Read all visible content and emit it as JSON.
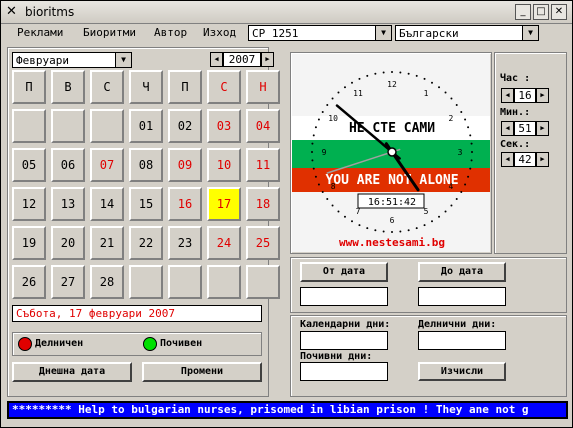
{
  "window": {
    "title": "bioritms"
  },
  "menu": [
    "Реклами",
    "Биоритми",
    "Автор",
    "Изход"
  ],
  "encoding_select": {
    "value": "CP 1251"
  },
  "language_select": {
    "value": "Български"
  },
  "calendar": {
    "month": "Февруари",
    "year": "2007",
    "weekdays": [
      "П",
      "В",
      "С",
      "Ч",
      "П",
      "С",
      "Н"
    ],
    "weeks": [
      [
        "",
        "",
        "",
        "01",
        "02",
        "03",
        "04"
      ],
      [
        "05",
        "06",
        "07",
        "08",
        "09",
        "10",
        "11"
      ],
      [
        "12",
        "13",
        "14",
        "15",
        "16",
        "17",
        "18"
      ],
      [
        "19",
        "20",
        "21",
        "22",
        "23",
        "24",
        "25"
      ],
      [
        "26",
        "27",
        "28",
        "",
        "",
        "",
        ""
      ]
    ],
    "red_days": [
      "03",
      "04",
      "07",
      "09",
      "10",
      "11",
      "16",
      "17",
      "18",
      "24",
      "25"
    ],
    "selected_day": "17",
    "selected_date_text": "Събота, 17 февруари 2007"
  },
  "legend": {
    "workday": "Делничен",
    "holiday": "Почивен",
    "workday_color": "#e00000",
    "holiday_color": "#00e000"
  },
  "buttons": {
    "today": "Днешна дата",
    "change": "Промени",
    "from_date": "От дата",
    "to_date": "До дата",
    "calculate": "Изчисли"
  },
  "clock": {
    "numbers": [
      "12",
      "1",
      "2",
      "3",
      "4",
      "5",
      "6",
      "7",
      "8",
      "9",
      "10",
      "11"
    ],
    "bg_text": "НЕ СТЕ САМИ",
    "red_text": "YOU ARE NOT ALONE",
    "digital_time": "16:51:42",
    "website": "www.nestesami.bg",
    "flag_colors": [
      "#ffffff",
      "#00b050",
      "#e03000"
    ]
  },
  "time": {
    "hour_label": "Час :",
    "hour": "16",
    "min_label": "Мин.:",
    "min": "51",
    "sec_label": "Сек.:",
    "sec": "42"
  },
  "fields": {
    "calendar_days_label": "Календарни дни:",
    "work_days_label": "Делнични дни:",
    "rest_days_label": "Почивни дни:"
  },
  "ticker": "********* Help to bulgarian nurses, prisomed in libian prison ! They ane not g"
}
